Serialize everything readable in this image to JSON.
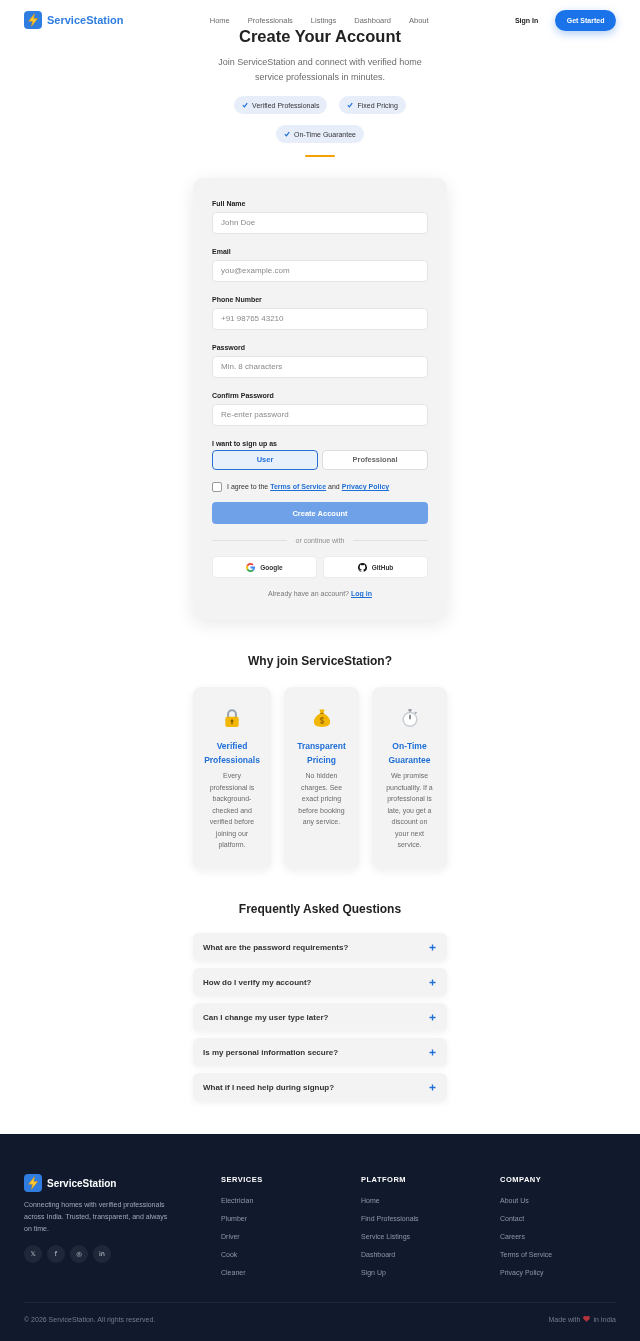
{
  "header": {
    "brand": "ServiceStation",
    "nav": [
      "Home",
      "Professionals",
      "Listings",
      "Dashboard",
      "About"
    ],
    "sign_in": "Sign In",
    "cta": "Get Started"
  },
  "hero": {
    "title": "Create Your Account",
    "subtitle": "Join ServiceStation and connect with verified home service professionals in minutes.",
    "badges": [
      "Verified Professionals",
      "Fixed Pricing",
      "On-Time Guarantee"
    ]
  },
  "signup_form": {
    "fields": [
      {
        "label": "Full Name",
        "placeholder": "John Doe"
      },
      {
        "label": "Email",
        "placeholder": "you@example.com"
      },
      {
        "label": "Phone Number",
        "placeholder": "+91 98765 43210"
      },
      {
        "label": "Password",
        "placeholder": "Min. 8 characters"
      },
      {
        "label": "Confirm Password",
        "placeholder": "Re-enter password"
      }
    ],
    "user_type": {
      "label": "I want to sign up as",
      "options": [
        {
          "label": "User",
          "selected": true
        },
        {
          "label": "Professional",
          "selected": false
        }
      ]
    },
    "agree": {
      "checked": false,
      "parts": [
        {
          "kind": "text",
          "text": "I agree to the"
        },
        {
          "kind": "link",
          "text": "Terms of Service"
        },
        {
          "kind": "text",
          "text": "and"
        },
        {
          "kind": "link",
          "text": "Privacy Policy"
        }
      ]
    },
    "submit": {
      "label": "Create Account",
      "disabled": true
    },
    "divider": "or continue with",
    "social_buttons": [
      {
        "kind": "google",
        "label": "Google"
      },
      {
        "kind": "github",
        "label": "GitHub"
      }
    ],
    "login_prompt": {
      "text": "Already have an account?",
      "link": "Log in"
    }
  },
  "why_join": {
    "title": "Why join ServiceStation?",
    "cards": [
      {
        "kind": "lock",
        "title": "Verified Professionals",
        "text": "Every professional is background-checked and verified before joining our platform."
      },
      {
        "kind": "money",
        "title": "Transparent Pricing",
        "text": "No hidden charges. See exact pricing before booking any service."
      },
      {
        "kind": "stopwatch",
        "title": "On-Time Guarantee",
        "text": "We promise punctuality. If a professional is late, you get a discount on your next service."
      }
    ]
  },
  "faq": {
    "title": "Frequently Asked Questions",
    "items": [
      {
        "question": "What are the password requirements?",
        "expanded": false
      },
      {
        "question": "How do I verify my account?",
        "expanded": false
      },
      {
        "question": "Can I change my user type later?",
        "expanded": false
      },
      {
        "question": "Is my personal information secure?",
        "expanded": false
      },
      {
        "question": "What if I need help during signup?",
        "expanded": false
      }
    ]
  },
  "footer": {
    "brand": "ServiceStation",
    "description": "Connecting homes with verified professionals across India. Trusted, transparent, and always on time.",
    "social": [
      "𝕏",
      "f",
      "◎",
      "in"
    ],
    "columns": [
      {
        "heading": "SERVICES",
        "links": [
          "Electrician",
          "Plumber",
          "Driver",
          "Cook",
          "Cleaner"
        ]
      },
      {
        "heading": "PLATFORM",
        "links": [
          "Home",
          "Find Professionals",
          "Service Listings",
          "Dashboard",
          "Sign Up"
        ]
      },
      {
        "heading": "COMPANY",
        "links": [
          "About Us",
          "Contact",
          "Careers",
          "Terms of Service",
          "Privacy Policy"
        ]
      }
    ],
    "copyright": "© 2026 ServiceStation. All rights reserved.",
    "credit": {
      "before": "Made with",
      "after": "in India"
    }
  }
}
